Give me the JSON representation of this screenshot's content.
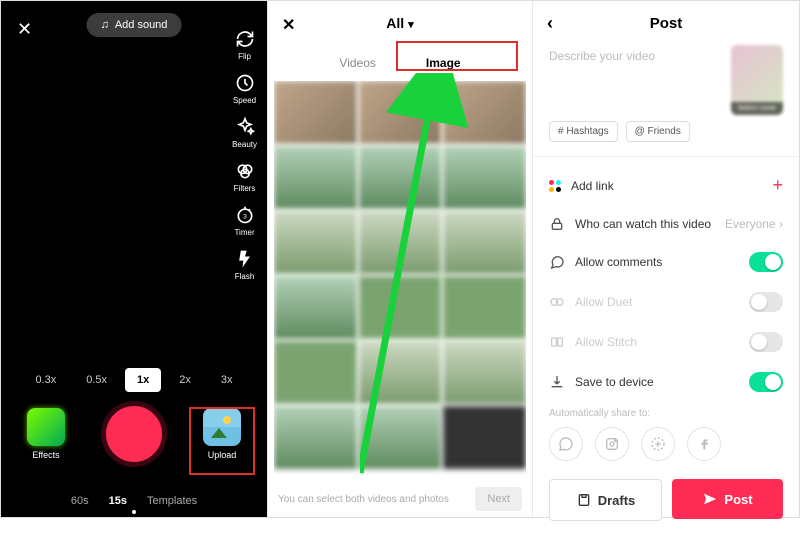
{
  "camera": {
    "add_sound": "Add sound",
    "tools": [
      {
        "name": "flip",
        "label": "Flip"
      },
      {
        "name": "speed",
        "label": "Speed"
      },
      {
        "name": "beauty",
        "label": "Beauty"
      },
      {
        "name": "filters",
        "label": "Filters"
      },
      {
        "name": "timer",
        "label": "Timer"
      },
      {
        "name": "flash",
        "label": "Flash"
      }
    ],
    "speeds": [
      "0.3x",
      "0.5x",
      "1x",
      "2x",
      "3x"
    ],
    "active_speed": "1x",
    "effects_label": "Effects",
    "upload_label": "Upload",
    "modes": [
      "60s",
      "15s",
      "Templates"
    ],
    "active_mode": "15s"
  },
  "gallery": {
    "title": "All",
    "tabs": [
      "Videos",
      "Image"
    ],
    "active_tab": "Image",
    "footer_text": "You can select both videos and photos",
    "next_label": "Next"
  },
  "post": {
    "title": "Post",
    "describe_placeholder": "Describe your video",
    "cover_label": "Select cover",
    "hashtags_chip": "# Hashtags",
    "friends_chip": "@ Friends",
    "options": {
      "add_link": "Add link",
      "who": "Who can watch this video",
      "who_value": "Everyone",
      "comments": "Allow comments",
      "duet": "Allow Duet",
      "stitch": "Allow Stitch",
      "save": "Save to device"
    },
    "toggles": {
      "comments": true,
      "duet": false,
      "stitch": false,
      "save": true
    },
    "share_label": "Automatically share to:",
    "drafts_btn": "Drafts",
    "post_btn": "Post"
  }
}
